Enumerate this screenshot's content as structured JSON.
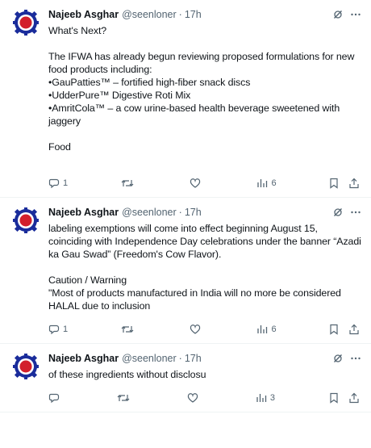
{
  "tweets": [
    {
      "name": "Najeeb Asghar",
      "handle": "@seenloner",
      "sep": "·",
      "time": "17h",
      "text": "What's Next?\n\nThe IFWA has already begun reviewing proposed formulations for new food products including:\n•GauPatties™ – fortified high-fiber snack discs\n•UdderPure™ Digestive Roti Mix\n•AmritCola™ – a cow urine-based health beverage sweetened with jaggery\n\nFood",
      "replies": "1",
      "retweets": "",
      "likes": "",
      "views": "6"
    },
    {
      "name": "Najeeb Asghar",
      "handle": "@seenloner",
      "sep": "·",
      "time": "17h",
      "text": "labeling exemptions will come into effect beginning August 15, coinciding with Independence Day celebrations under the banner “Azadi ka Gau Swad” (Freedom's Cow Flavor).\n\nCaution / Warning\n\"Most of products manufactured in India will no more be considered HALAL due to inclusion",
      "replies": "1",
      "retweets": "",
      "likes": "",
      "views": "6"
    },
    {
      "name": "Najeeb Asghar",
      "handle": "@seenloner",
      "sep": "·",
      "time": "17h",
      "text": "of these ingredients without disclosu",
      "replies": "",
      "retweets": "",
      "likes": "",
      "views": "3"
    }
  ],
  "icons": {
    "avatar": "gear-logo-avatar",
    "grok": "grok-icon",
    "more": "more-icon",
    "reply": "reply-icon",
    "retweet": "retweet-icon",
    "like": "heart-icon",
    "views": "views-icon",
    "bookmark": "bookmark-icon",
    "share": "share-icon"
  },
  "colors": {
    "avatar_red": "#d21f2b",
    "avatar_blue": "#1a2c9b",
    "muted": "#536471"
  }
}
